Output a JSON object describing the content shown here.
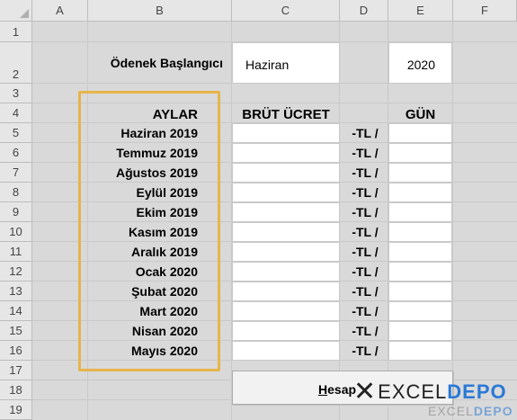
{
  "columns": [
    "A",
    "B",
    "C",
    "D",
    "E",
    "F"
  ],
  "rows": [
    "1",
    "2",
    "3",
    "4",
    "5",
    "6",
    "7",
    "8",
    "9",
    "10",
    "11",
    "12",
    "13",
    "14",
    "15",
    "16",
    "17",
    "18",
    "19"
  ],
  "form": {
    "start_label": "Ödenek Başlangıcı",
    "start_month_value": "Haziran",
    "start_year_value": "2020"
  },
  "table": {
    "header_months": "AYLAR",
    "header_gross": "BRÜT ÜCRET",
    "header_days": "GÜN",
    "unit_label": "-TL /",
    "months": [
      "Haziran 2019",
      "Temmuz 2019",
      "Ağustos 2019",
      "Eylül 2019",
      "Ekim 2019",
      "Kasım 2019",
      "Aralık 2019",
      "Ocak 2020",
      "Şubat 2020",
      "Mart 2020",
      "Nisan 2020",
      "Mayıs 2020"
    ]
  },
  "button": {
    "hotkey_letter": "H",
    "label_rest": "esap"
  },
  "watermark": {
    "brand_left": "EXCEL",
    "brand_right": "DEPO"
  },
  "colors": {
    "highlight_border": "#e6b54a",
    "brand_blue": "#2a79d6"
  }
}
